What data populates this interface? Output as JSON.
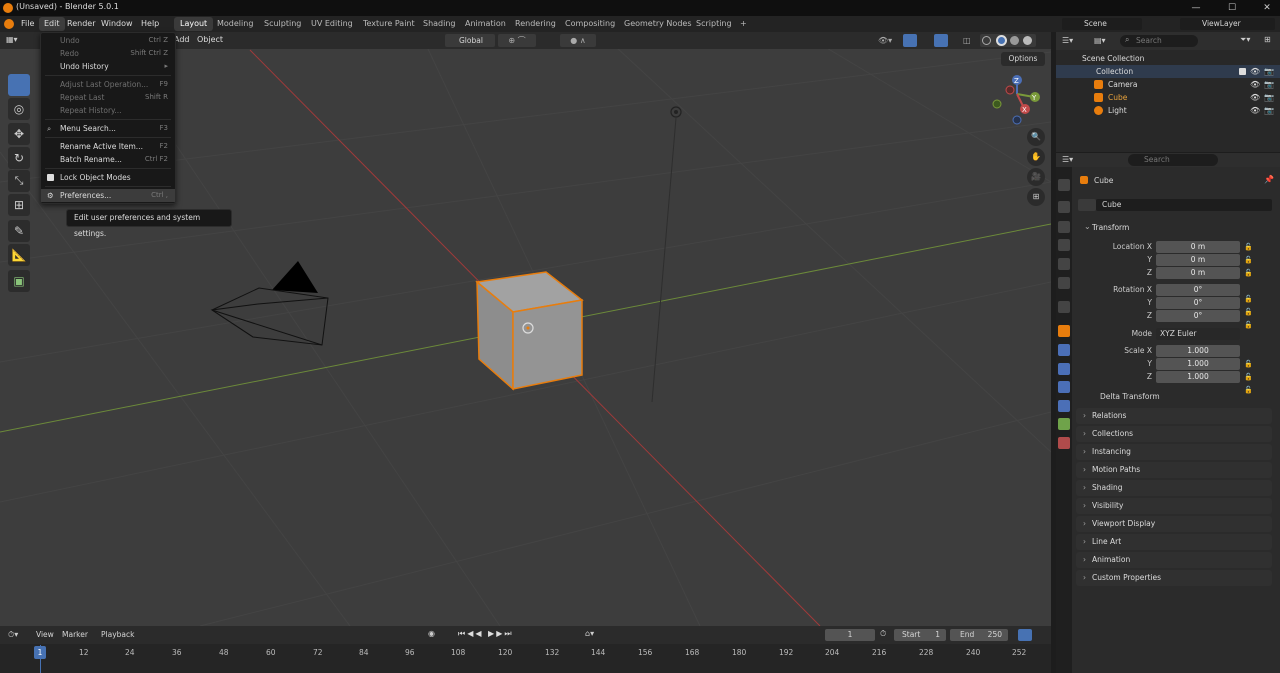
{
  "title": "(Unsaved) - Blender 5.0.1",
  "menubar": {
    "items": [
      "File",
      "Edit",
      "Render",
      "Window",
      "Help"
    ],
    "workspaces": [
      "Layout",
      "Modeling",
      "Sculpting",
      "UV Editing",
      "Texture Paint",
      "Shading",
      "Animation",
      "Rendering",
      "Compositing",
      "Geometry Nodes",
      "Scripting",
      "+"
    ],
    "scene": "Scene",
    "view_layer": "ViewLayer"
  },
  "viewport_header": {
    "menu_add": "Add",
    "menu_object": "Object",
    "orientation": "Global",
    "options": "Options"
  },
  "edit_menu": {
    "items": [
      {
        "label": "Undo",
        "shortcut": "Ctrl Z",
        "disabled": true
      },
      {
        "label": "Redo",
        "shortcut": "Shift Ctrl Z",
        "disabled": true
      },
      {
        "label": "Undo History",
        "shortcut": "",
        "disabled": false
      },
      {
        "label": "Adjust Last Operation...",
        "shortcut": "F9",
        "disabled": true
      },
      {
        "label": "Repeat Last",
        "shortcut": "Shift R",
        "disabled": true
      },
      {
        "label": "Repeat History...",
        "shortcut": "",
        "disabled": true
      },
      {
        "label": "Menu Search...",
        "shortcut": "F3",
        "disabled": false
      },
      {
        "label": "Rename Active Item...",
        "shortcut": "F2",
        "disabled": false
      },
      {
        "label": "Batch Rename...",
        "shortcut": "Ctrl F2",
        "disabled": false
      },
      {
        "label": "Lock Object Modes",
        "shortcut": "",
        "disabled": false
      },
      {
        "label": "Preferences...",
        "shortcut": "Ctrl ,",
        "disabled": false
      }
    ],
    "tooltip": "Edit user preferences and system settings."
  },
  "outliner": {
    "search_placeholder": "Search",
    "root": "Scene Collection",
    "collection": "Collection",
    "objects": [
      "Camera",
      "Cube",
      "Light"
    ]
  },
  "properties": {
    "search_placeholder": "Search",
    "object_name": "Cube",
    "data_name": "Cube",
    "transform_label": "Transform",
    "location": {
      "label_x": "Location X",
      "label_y": "Y",
      "label_z": "Z",
      "x": "0 m",
      "y": "0 m",
      "z": "0 m"
    },
    "rotation": {
      "label_x": "Rotation X",
      "label_y": "Y",
      "label_z": "Z",
      "x": "0°",
      "y": "0°",
      "z": "0°"
    },
    "mode_label": "Mode",
    "mode_value": "XYZ Euler",
    "scale": {
      "label_x": "Scale X",
      "label_y": "Y",
      "label_z": "Z",
      "x": "1.000",
      "y": "1.000",
      "z": "1.000"
    },
    "delta_transform": "Delta Transform",
    "panels": [
      "Relations",
      "Collections",
      "Instancing",
      "Motion Paths",
      "Shading",
      "Visibility",
      "Viewport Display",
      "Line Art",
      "Animation",
      "Custom Properties"
    ]
  },
  "timeline": {
    "menus": [
      "View",
      "Marker",
      "Playback"
    ],
    "current_frame": "1",
    "start_label": "Start",
    "start": "1",
    "end_label": "End",
    "end": "250",
    "ruler": [
      "1",
      "12",
      "24",
      "36",
      "48",
      "60",
      "72",
      "84",
      "96",
      "108",
      "120",
      "132",
      "144",
      "156",
      "168",
      "180",
      "192",
      "204",
      "216",
      "228",
      "240",
      "252"
    ]
  },
  "colors": {
    "accent": "#4772b3",
    "selection": "#e87d0d"
  }
}
